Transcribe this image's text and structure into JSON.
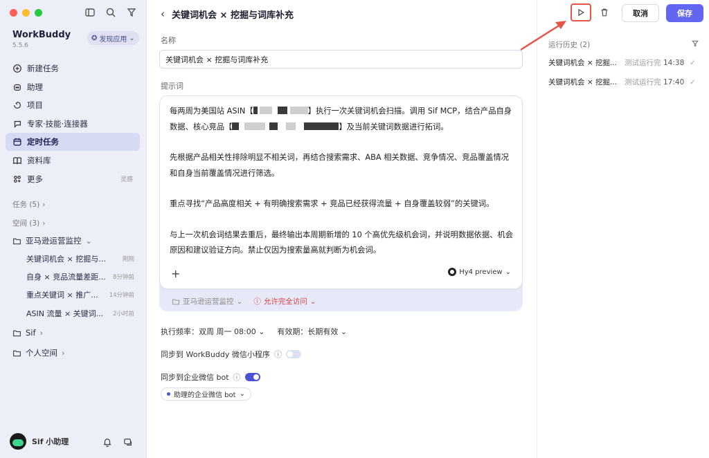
{
  "sidebar": {
    "brand_name": "WorkBuddy",
    "version": "5.5.6",
    "discover_label": "发现应用",
    "nav": [
      {
        "label": "新建任务",
        "icon": "plus-circle-icon"
      },
      {
        "label": "助理",
        "icon": "robot-icon"
      },
      {
        "label": "项目",
        "icon": "project-icon"
      },
      {
        "label": "专家·技能·连接器",
        "icon": "expert-icon"
      },
      {
        "label": "定时任务",
        "icon": "calendar-icon",
        "active": true
      },
      {
        "label": "资料库",
        "icon": "book-icon"
      },
      {
        "label": "更多",
        "icon": "grid-icon",
        "extra": "灵感"
      }
    ],
    "tasks_section": "任务 (5)",
    "spaces_section": "空间 (3)",
    "folder_amazon": "亚马逊运营监控",
    "sub_items": [
      {
        "title": "关键词机会 × 挖掘与词...",
        "time": "刚刚"
      },
      {
        "title": "自身 × 竞品流量差距...",
        "time": "8分钟前"
      },
      {
        "title": "重点关键词 × 推广...",
        "time": "14分钟前"
      },
      {
        "title": "ASIN 流量 × 关键词...",
        "time": "2小时前"
      }
    ],
    "folder_sif": "Sif",
    "folder_personal": "个人空间",
    "user_name": "Sif 小助理"
  },
  "main": {
    "title": "关键词机会 × 挖掘与词库补充",
    "name_label": "名称",
    "name_value": "关键词机会 × 挖掘与词库补充",
    "prompt_label": "提示词",
    "prompt": {
      "p1a": "每两周为美国站 ASIN【",
      "p1b": "】执行一次关键词机会扫描。调用 Sif MCP，结合产品自身数据、核心竞品【",
      "p1c": "】及当前关键词数据进行拓词。",
      "p2": "先根据产品相关性排除明显不相关词，再结合搜索需求、ABA 相关数据、竞争情况、竞品覆盖情况和自身当前覆盖情况进行筛选。",
      "p3": "重点寻找“产品高度相关 + 有明确搜索需求 + 竞品已经获得流量 + 自身覆盖较弱”的关键词。",
      "p4": "与上一次机会词结果去重后，最终输出本周期新增的 10 个高优先级机会词，并说明数据依据、机会原因和建议验证方向。禁止仅因为搜索量高就判断为机会词。"
    },
    "model_label": "Hy4 preview",
    "workspace_chip": "亚马逊运营监控",
    "access_chip": "允许完全访问",
    "frequency": "执行频率：双周 周一 08:00",
    "validity": "有效期：长期有效",
    "sync_miniprogram": "同步到 WorkBuddy 微信小程序",
    "sync_wecom": "同步到企业微信 bot",
    "bot_chip": "助理的企业微信 bot",
    "miniprogram_on": false,
    "wecom_on": true
  },
  "right": {
    "cancel_label": "取消",
    "save_label": "保存",
    "history_title": "运行历史 (2)",
    "history": [
      {
        "name": "关键词机会 × 挖掘...",
        "status": "测试运行完成",
        "time": "14:38"
      },
      {
        "name": "关键词机会 × 挖掘...",
        "status": "测试运行完成",
        "time": "17:40"
      }
    ]
  },
  "colors": {
    "accent": "#6366f0",
    "annotation": "#e5554a",
    "sidebar_bg": "#eceef8"
  }
}
